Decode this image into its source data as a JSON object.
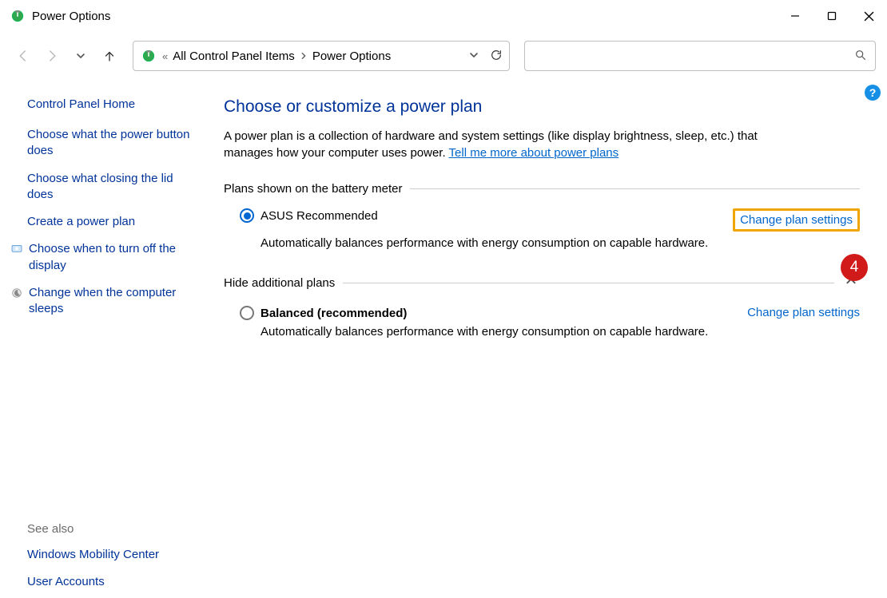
{
  "window": {
    "title": "Power Options"
  },
  "breadcrumb": {
    "item1": "All Control Panel Items",
    "item2": "Power Options"
  },
  "sidebar": {
    "home": "Control Panel Home",
    "tasks": [
      "Choose what the power button does",
      "Choose what closing the lid does",
      "Create a power plan",
      "Choose when to turn off the display",
      "Change when the computer sleeps"
    ],
    "see_also_hdr": "See also",
    "see_also_items": [
      "Windows Mobility Center",
      "User Accounts"
    ]
  },
  "main": {
    "title": "Choose or customize a power plan",
    "desc_1": "A power plan is a collection of hardware and system settings (like display brightness, sleep, etc.) that manages how your computer uses power. ",
    "desc_link": "Tell me more about power plans",
    "section1_hdr": "Plans shown on the battery meter",
    "plan1_name": "ASUS Recommended",
    "plan1_link": "Change plan settings",
    "plan1_desc": "Automatically balances performance with energy consumption on capable hardware.",
    "section2_hdr": "Hide additional plans",
    "plan2_name": "Balanced (recommended)",
    "plan2_link": "Change plan settings",
    "plan2_desc": "Automatically balances performance with energy consumption on capable hardware."
  },
  "annotations": {
    "badge": "4",
    "help": "?"
  }
}
